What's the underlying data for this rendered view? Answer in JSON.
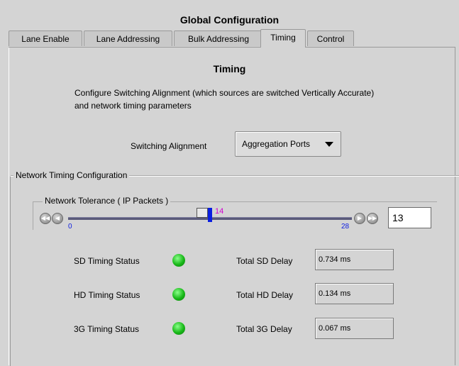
{
  "window": {
    "title": "Global Configuration"
  },
  "tabs": [
    {
      "label": "Lane Enable"
    },
    {
      "label": "Lane Addressing"
    },
    {
      "label": "Bulk Addressing"
    },
    {
      "label": "Timing",
      "active": true
    },
    {
      "label": "Control"
    }
  ],
  "timing": {
    "title": "Timing",
    "description": "Configure Switching Alignment (which sources are switched Vertically Accurate) and network timing parameters",
    "switching_alignment": {
      "label": "Switching Alignment",
      "value": "Aggregation Ports"
    }
  },
  "network": {
    "group_label": "Network Timing Configuration",
    "tolerance": {
      "label": "Network Tolerance ( IP Packets )",
      "min": "0",
      "max": "28",
      "value": "14",
      "field_value": "13"
    },
    "rows": [
      {
        "status_label": "SD Timing Status",
        "delay_label": "Total SD Delay",
        "delay_value": "0.734 ms"
      },
      {
        "status_label": "HD Timing Status",
        "delay_label": "Total HD Delay",
        "delay_value": "0.134 ms"
      },
      {
        "status_label": "3G Timing Status",
        "delay_label": "Total 3G Delay",
        "delay_value": "0.067 ms"
      }
    ]
  },
  "colors": {
    "status_ok": "#18b818",
    "slider_thumb": "#0a1ee0",
    "slider_value": "#d000d0",
    "slider_range": "#1020e0"
  }
}
